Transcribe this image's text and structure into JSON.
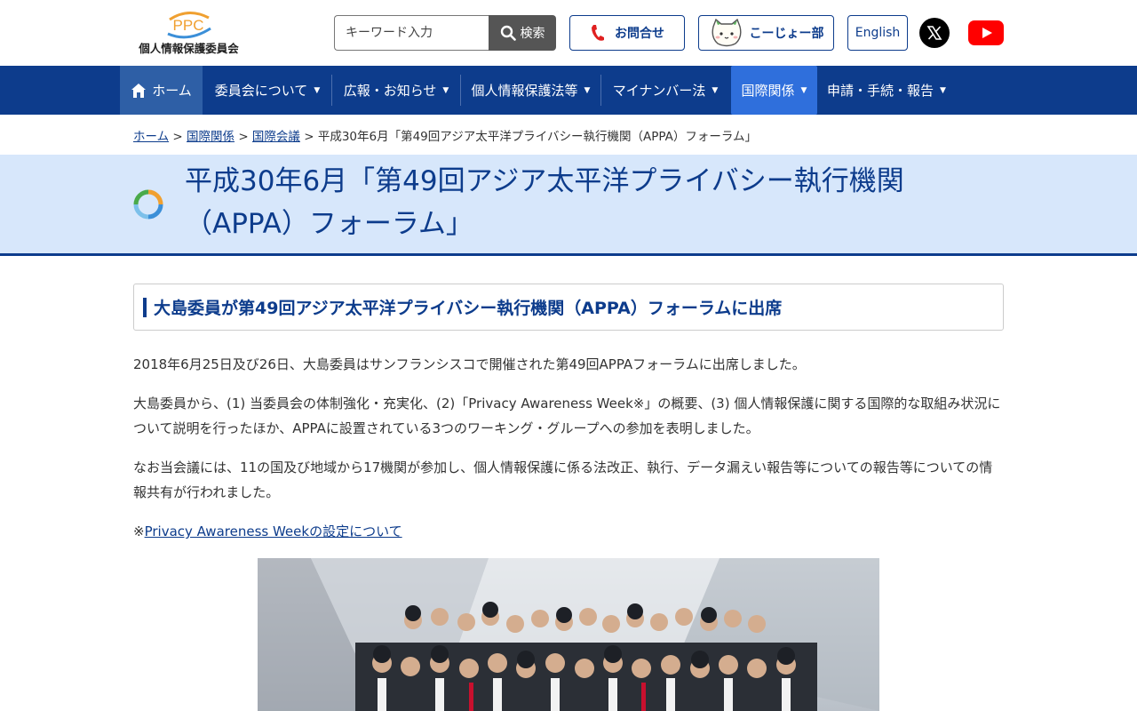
{
  "header": {
    "logo_mark": "PPC",
    "logo_text": "個人情報保護委員会",
    "search_placeholder": "キーワード入力",
    "search_button": "検索",
    "contact_label": "お問合せ",
    "kojo_label": "こーじょー部",
    "english_label": "English"
  },
  "nav": {
    "items": [
      {
        "label": "ホーム"
      },
      {
        "label": "委員会について"
      },
      {
        "label": "広報・お知らせ"
      },
      {
        "label": "個人情報保護法等"
      },
      {
        "label": "マイナンバー法"
      },
      {
        "label": "国際関係"
      },
      {
        "label": "申請・手続・報告"
      }
    ]
  },
  "breadcrumb": {
    "items": [
      "ホーム",
      "国際関係",
      "国際会議"
    ],
    "current": "平成30年6月「第49回アジア太平洋プライバシー執行機関（APPA）フォーラム」"
  },
  "page": {
    "title": "平成30年6月「第49回アジア太平洋プライバシー執行機関（APPA）フォーラム」",
    "subheading": "大島委員が第49回アジア太平洋プライバシー執行機関（APPA）フォーラムに出席",
    "paragraphs": [
      "2018年6月25日及び26日、大島委員はサンフランシスコで開催された第49回APPAフォーラムに出席しました。",
      "大島委員から、(1) 当委員会の体制強化・充実化、(2)「Privacy Awareness Week※」の概要、(3) 個人情報保護に関する国際的な取組み状況について説明を行ったほか、APPAに設置されている3つのワーキング・グループへの参加を表明しました。",
      "なお当会議には、11の国及び地域から17機関が参加し、個人情報保護に係る法改正、執行、データ漏えい報告等についての報告等についての情報共有が行われました。"
    ],
    "note_prefix": "※",
    "note_link": "Privacy Awareness Weekの設定について"
  },
  "colors": {
    "brand_navy": "#0d3c8c",
    "nav_active": "#2f6fdc",
    "title_band": "#d7e7fb"
  }
}
